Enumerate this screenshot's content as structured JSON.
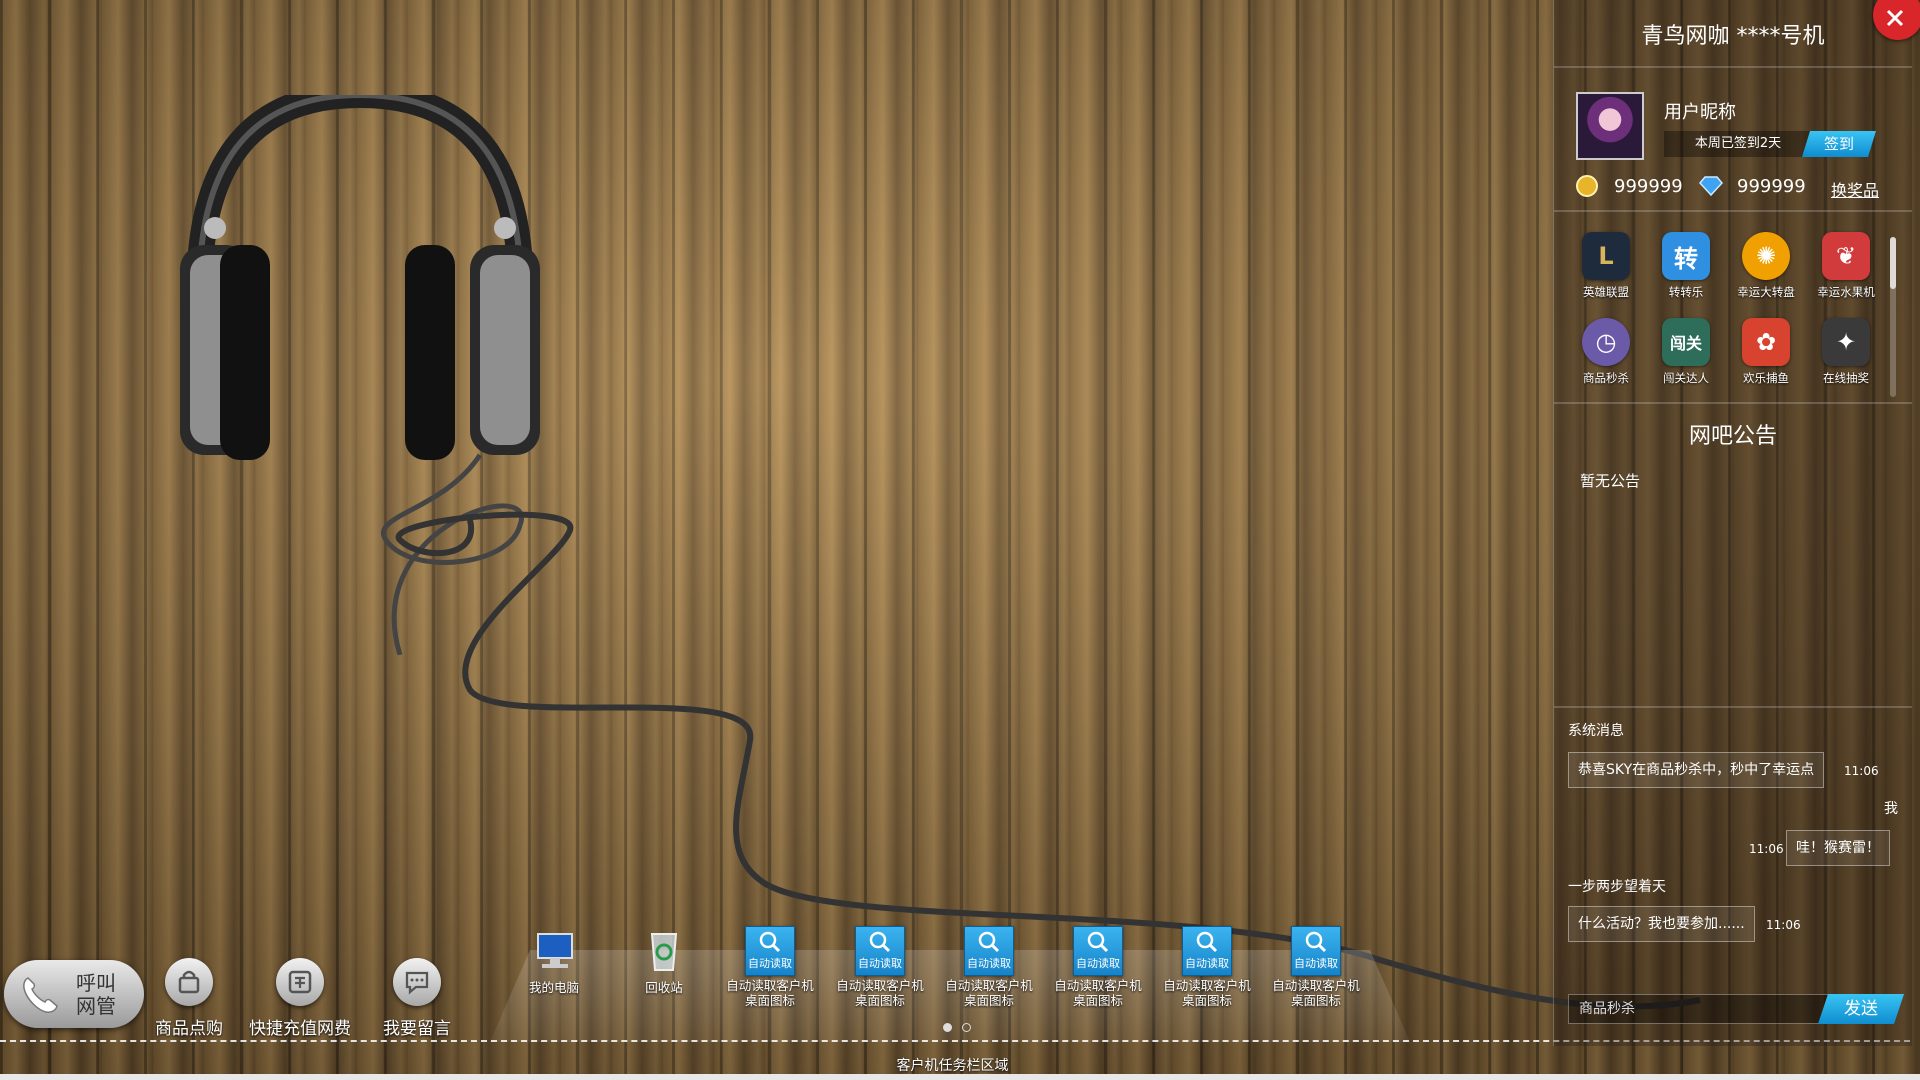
{
  "colors": {
    "accent_blue": "#1a9ee0",
    "close_red": "#d9262a"
  },
  "quick_actions": [
    {
      "label": "呼叫网管",
      "icon": "phone-icon"
    },
    {
      "label": "商品点购",
      "icon": "shopping-bag-icon"
    },
    {
      "label": "快捷充值网费",
      "icon": "recharge-icon"
    },
    {
      "label": "我要留言",
      "icon": "message-icon"
    }
  ],
  "call": {
    "line1": "呼叫",
    "line2": "网管"
  },
  "desktop_icons": [
    {
      "label": "我的电脑",
      "icon": "computer-icon"
    },
    {
      "label": "回收站",
      "icon": "recycle-bin-icon"
    },
    {
      "label": "自动读取客户机桌面图标",
      "tile_text": "自动读取",
      "icon": "search-icon"
    },
    {
      "label": "自动读取客户机桌面图标",
      "tile_text": "自动读取",
      "icon": "search-icon"
    },
    {
      "label": "自动读取客户机桌面图标",
      "tile_text": "自动读取",
      "icon": "search-icon"
    },
    {
      "label": "自动读取客户机桌面图标",
      "tile_text": "自动读取",
      "icon": "search-icon"
    },
    {
      "label": "自动读取客户机桌面图标",
      "tile_text": "自动读取",
      "icon": "search-icon"
    },
    {
      "label": "自动读取客户机桌面图标",
      "tile_text": "自动读取",
      "icon": "search-icon"
    }
  ],
  "pager": {
    "pages": 2,
    "current": 1
  },
  "taskbar": {
    "label": "客户机任务栏区域"
  },
  "panel": {
    "title": "青鸟网咖  ****号机",
    "user": {
      "nickname": "用户昵称",
      "signin_info": "本周已签到2天",
      "signin_button": "签到"
    },
    "wallet": {
      "coins": "999999",
      "diamonds": "999999",
      "redeem": "换奖品"
    },
    "apps": [
      {
        "label": "英雄联盟",
        "icon": "league-icon",
        "glyph": "L",
        "color": "#1e2b3c"
      },
      {
        "label": "转转乐",
        "icon": "spin-fun-icon",
        "glyph": "转",
        "color": "#2f8fe0"
      },
      {
        "label": "幸运大转盘",
        "icon": "lucky-wheel-icon",
        "glyph": "✺",
        "color": "#f0a000"
      },
      {
        "label": "幸运水果机",
        "icon": "fruit-machine-icon",
        "glyph": "❦",
        "color": "#d23b3b"
      },
      {
        "label": "商品秒杀",
        "icon": "clock-icon",
        "glyph": "◷",
        "color": "#6b5aa8"
      },
      {
        "label": "闯关达人",
        "icon": "challenge-icon",
        "glyph": "闯关",
        "color": "#2d6d5a"
      },
      {
        "label": "欢乐捕鱼",
        "icon": "fish-icon",
        "glyph": "✿",
        "color": "#d8432f"
      },
      {
        "label": "在线抽奖",
        "icon": "magic-hat-icon",
        "glyph": "✦",
        "color": "#3a3a3a"
      }
    ],
    "notice": {
      "title": "网吧公告",
      "body": "暂无公告"
    },
    "chat": {
      "title": "系统消息",
      "messages": [
        {
          "text": "恭喜SKY在商品秒杀中，秒中了幸运点",
          "time": "11:06"
        },
        {
          "sender": "我",
          "text": "哇！猴赛雷！",
          "time": "11:06"
        },
        {
          "sender": "一步两步望着天",
          "text": "什么活动？我也要参加......",
          "time": "11:06"
        }
      ],
      "input_value": "商品秒杀",
      "send_button": "发送"
    }
  }
}
